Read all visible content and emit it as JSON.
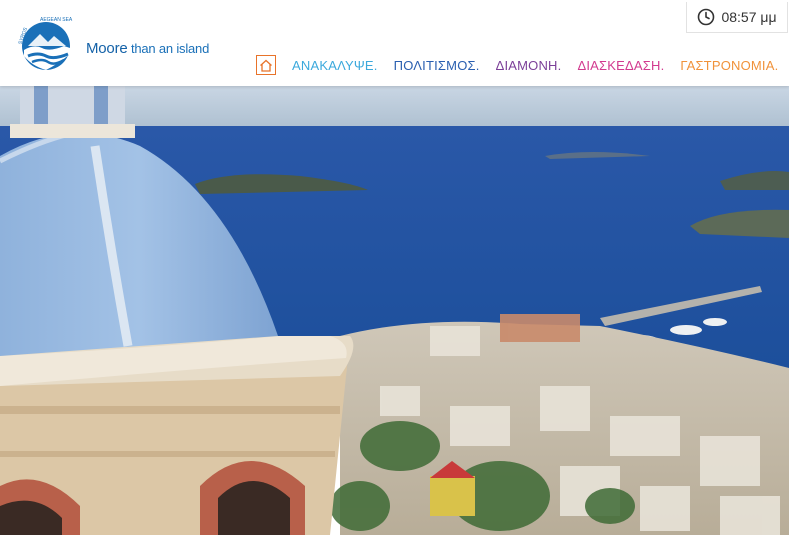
{
  "brand": {
    "tagline_main": "Moore",
    "tagline_rest": " than an island",
    "logo_top_left": "SYROS",
    "logo_top_right": "AEGEAN SEA",
    "color": "#1a70b8"
  },
  "clock": {
    "time": "08:57 μμ",
    "icon": "clock-icon"
  },
  "nav": {
    "home_icon": "home-icon",
    "items": [
      {
        "label": "ΑΝΑΚΑΛΥΨΕ.",
        "color": "#3ca9dc"
      },
      {
        "label": "ΠΟΛΙΤΙΣΜΟΣ.",
        "color": "#2a5fb0"
      },
      {
        "label": "ΔΙΑΜΟΝΗ.",
        "color": "#7b3f98"
      },
      {
        "label": "ΔΙΑΣΚΕΔΑΣΗ.",
        "color": "#d23a8f"
      },
      {
        "label": "ΓΑΣΤΡΟΝΟΜΙΑ.",
        "color": "#f0923a"
      }
    ]
  },
  "hero": {
    "description_icon": "hero-image"
  }
}
